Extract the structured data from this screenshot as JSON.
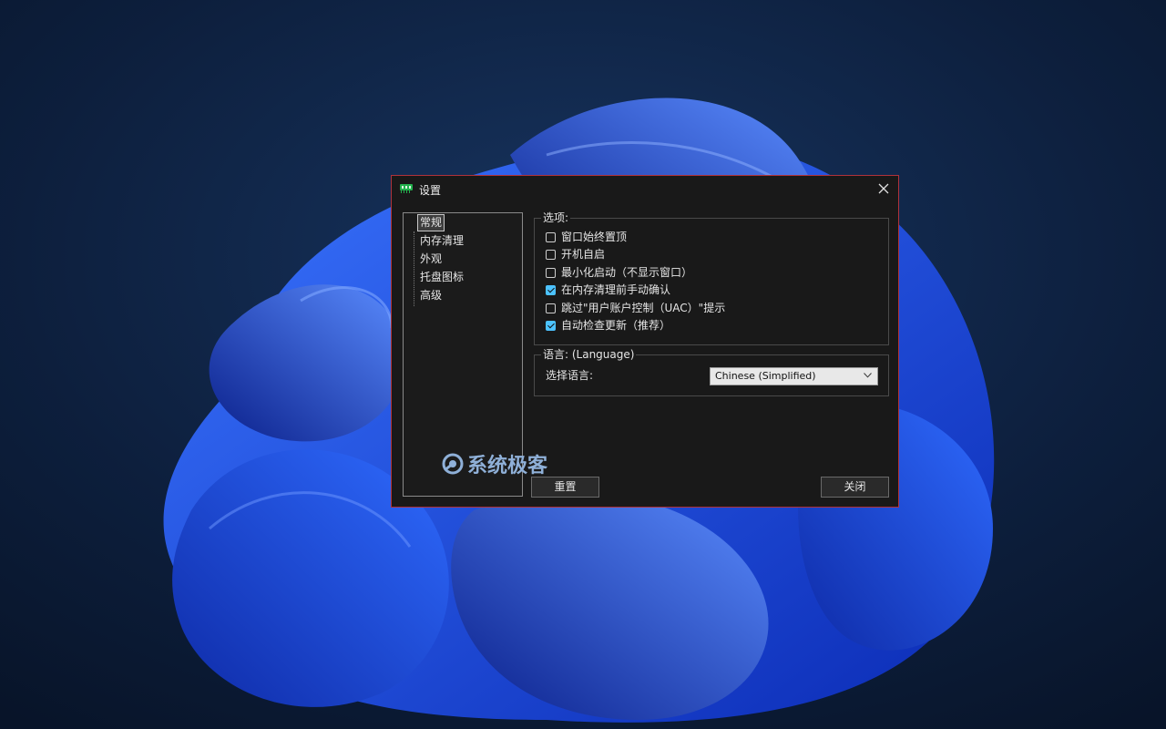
{
  "dialog": {
    "title": "设置",
    "icon": "memory-chip-icon",
    "close_icon": "close-icon"
  },
  "nav": {
    "items": [
      {
        "label": "常规",
        "selected": true
      },
      {
        "label": "内存清理",
        "selected": false
      },
      {
        "label": "外观",
        "selected": false
      },
      {
        "label": "托盘图标",
        "selected": false
      },
      {
        "label": "高级",
        "selected": false
      }
    ]
  },
  "options": {
    "title": "选项:",
    "items": [
      {
        "label": "窗口始终置顶",
        "checked": false
      },
      {
        "label": "开机自启",
        "checked": false
      },
      {
        "label": "最小化启动（不显示窗口）",
        "checked": false
      },
      {
        "label": "在内存清理前手动确认",
        "checked": true
      },
      {
        "label": "跳过\"用户账户控制（UAC）\"提示",
        "checked": false
      },
      {
        "label": "自动检查更新（推荐）",
        "checked": true
      }
    ]
  },
  "language": {
    "title": "语言: (Language)",
    "label": "选择语言:",
    "selected": "Chinese (Simplified)"
  },
  "buttons": {
    "reset": "重置",
    "close": "关闭"
  },
  "watermark": {
    "text": "系统极客"
  },
  "colors": {
    "dialog_bg": "#191919",
    "dialog_border": "#b0323a",
    "check_accent": "#4cc2ff",
    "wallpaper_blue": "#1a4fe0"
  }
}
